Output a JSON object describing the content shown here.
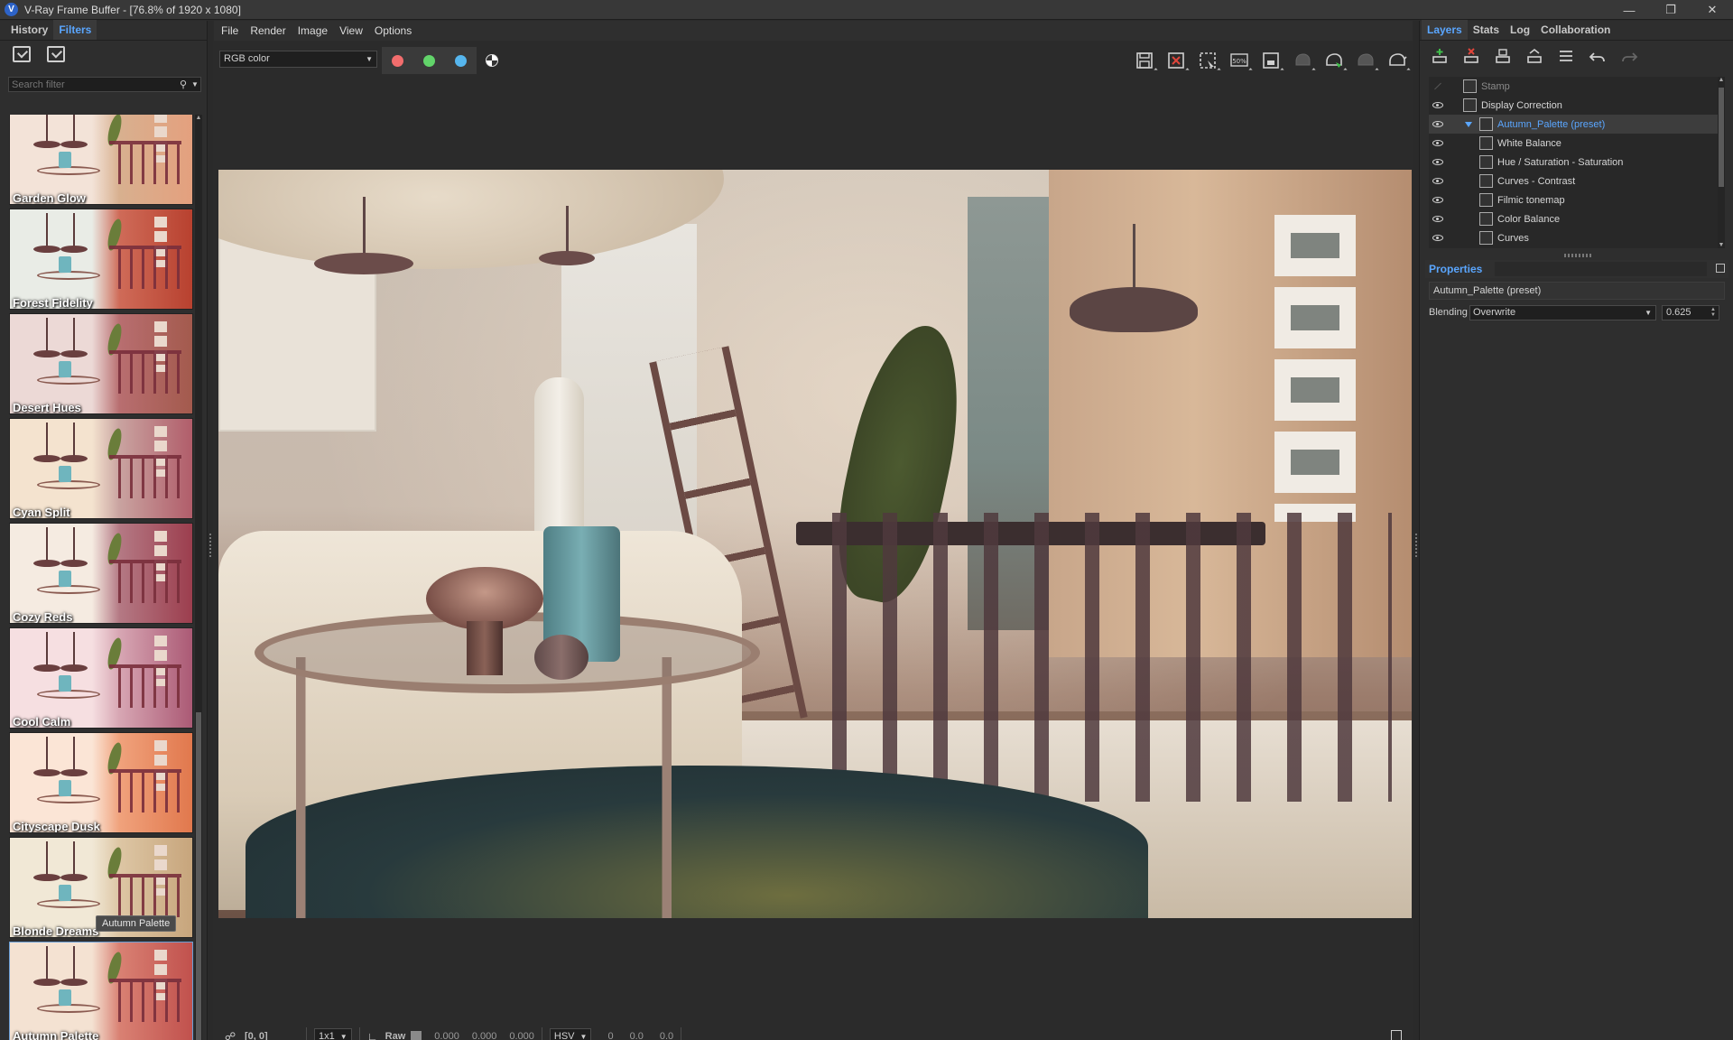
{
  "window": {
    "title": "V-Ray Frame Buffer - [76.8% of 1920 x 1080]",
    "logo": "V",
    "controls": {
      "minimize": "—",
      "restore": "❐",
      "close": "✕"
    }
  },
  "left_panel": {
    "tabs": [
      {
        "label": "History"
      },
      {
        "label": "Filters",
        "active": true
      }
    ],
    "search_placeholder": "Search filter",
    "tooltip": "Autumn Palette",
    "filters": [
      {
        "label": "Garden Glow",
        "tint": [
          "#f3e3d8",
          "#d8b08f",
          "#e4a07e"
        ]
      },
      {
        "label": "Forest Fidelity",
        "tint": [
          "#e9ece6",
          "#cf6b58",
          "#b8412f"
        ]
      },
      {
        "label": "Desert Hues",
        "tint": [
          "#ecd9d6",
          "#b86e70",
          "#a35a4d"
        ]
      },
      {
        "label": "Cyan Split",
        "tint": [
          "#f4e3cf",
          "#c9a3a0",
          "#b15d6a"
        ]
      },
      {
        "label": "Cozy Reds",
        "tint": [
          "#f5ebe1",
          "#b47984",
          "#9c3e4e"
        ]
      },
      {
        "label": "Cool Calm",
        "tint": [
          "#f6dfe1",
          "#d7a6b3",
          "#ab5a75"
        ]
      },
      {
        "label": "Cityscape Dusk",
        "tint": [
          "#fbe5d6",
          "#f0a27c",
          "#e1784d"
        ]
      },
      {
        "label": "Blonde Dreams",
        "tint": [
          "#f1e8d6",
          "#ddc6a4",
          "#c7a57c"
        ]
      },
      {
        "label": "Autumn Palette",
        "tint": [
          "#f4e2d2",
          "#d98173",
          "#c1514d"
        ],
        "selected": true
      }
    ]
  },
  "menu": [
    "File",
    "Render",
    "Image",
    "View",
    "Options"
  ],
  "toolbar": {
    "channel": "RGB color",
    "channels": [
      {
        "name": "red-channel",
        "color": "#f26d6d"
      },
      {
        "name": "green-channel",
        "color": "#62d46a"
      },
      {
        "name": "blue-channel",
        "color": "#56b6ee"
      }
    ],
    "zoom_badge": "50%",
    "tools": [
      "save-image-icon",
      "clear-image-icon",
      "region-render-icon",
      "test-resolution-icon",
      "follow-mouse-icon",
      "render-last-icon",
      "interactive-render-icon",
      "stop-render-icon",
      "render-teapot-icon"
    ]
  },
  "status": {
    "coords": "[0, 0]",
    "sample_size": "1x1",
    "raw_label": "Raw",
    "rgb_values": [
      "0.000",
      "0.000",
      "0.000"
    ],
    "color_model": "HSV",
    "hsv_values": [
      "0",
      "0.0",
      "0.0"
    ]
  },
  "right_panel": {
    "tabs": [
      {
        "label": "Layers",
        "active": true
      },
      {
        "label": "Stats"
      },
      {
        "label": "Log"
      },
      {
        "label": "Collaboration"
      }
    ],
    "layers": [
      {
        "name": "Stamp",
        "visible": false,
        "indent": 0,
        "icon": "stamp-icon"
      },
      {
        "name": "Display Correction",
        "visible": true,
        "indent": 0,
        "icon": "curve-icon"
      },
      {
        "name": "Autumn_Palette (preset)",
        "visible": true,
        "indent": 1,
        "icon": "folder-icon",
        "selected": true
      },
      {
        "name": "White Balance",
        "visible": true,
        "indent": 2,
        "icon": "white-balance-icon"
      },
      {
        "name": "Hue / Saturation - Saturation",
        "visible": true,
        "indent": 2,
        "icon": "hue-saturation-icon"
      },
      {
        "name": "Curves - Contrast",
        "visible": true,
        "indent": 2,
        "icon": "curve-icon"
      },
      {
        "name": "Filmic tonemap",
        "visible": true,
        "indent": 2,
        "icon": "tonemap-icon"
      },
      {
        "name": "Color Balance",
        "visible": true,
        "indent": 2,
        "icon": "color-balance-icon"
      },
      {
        "name": "Curves",
        "visible": true,
        "indent": 2,
        "icon": "curve-icon"
      }
    ],
    "properties": {
      "title": "Properties",
      "name": "Autumn_Palette (preset)",
      "blending_label": "Blending",
      "blending_mode": "Overwrite",
      "blending_amount": "0.625"
    }
  }
}
